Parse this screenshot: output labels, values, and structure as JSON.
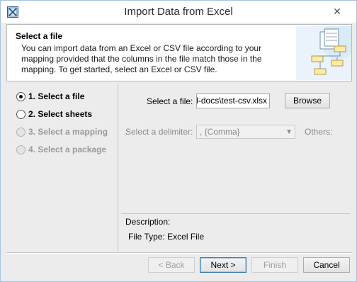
{
  "window": {
    "title": "Import Data from Excel",
    "close_glyph": "✕"
  },
  "header": {
    "title": "Select a file",
    "description": "You can import data from an Excel or CSV file according to your mapping provided that the columns in the file match those in the mapping. To get started, select an Excel or CSV file."
  },
  "steps": [
    {
      "label": "1. Select a file",
      "selected": true,
      "enabled": true
    },
    {
      "label": "2. Select sheets",
      "selected": false,
      "enabled": true
    },
    {
      "label": "3. Select a mapping",
      "selected": false,
      "enabled": false
    },
    {
      "label": "4. Select a package",
      "selected": false,
      "enabled": false
    }
  ],
  "form": {
    "file_label": "Select a file:",
    "file_value": "il-docs\\test-csv.xlsx",
    "browse_label": "Browse",
    "delimiter_label": "Select a delimiter:",
    "delimiter_value": ", {Comma}",
    "others_label": "Others:"
  },
  "description": {
    "title": "Description:",
    "value": "File Type: Excel File"
  },
  "buttons": {
    "back": "< Back",
    "next": "Next >",
    "finish": "Finish",
    "cancel": "Cancel"
  },
  "colors": {
    "accent": "#3c7fb1",
    "disabled_text": "#9a9a9a"
  },
  "icons": {
    "app": "window-icon",
    "header_art": "spreadsheet-diagram-icon"
  }
}
